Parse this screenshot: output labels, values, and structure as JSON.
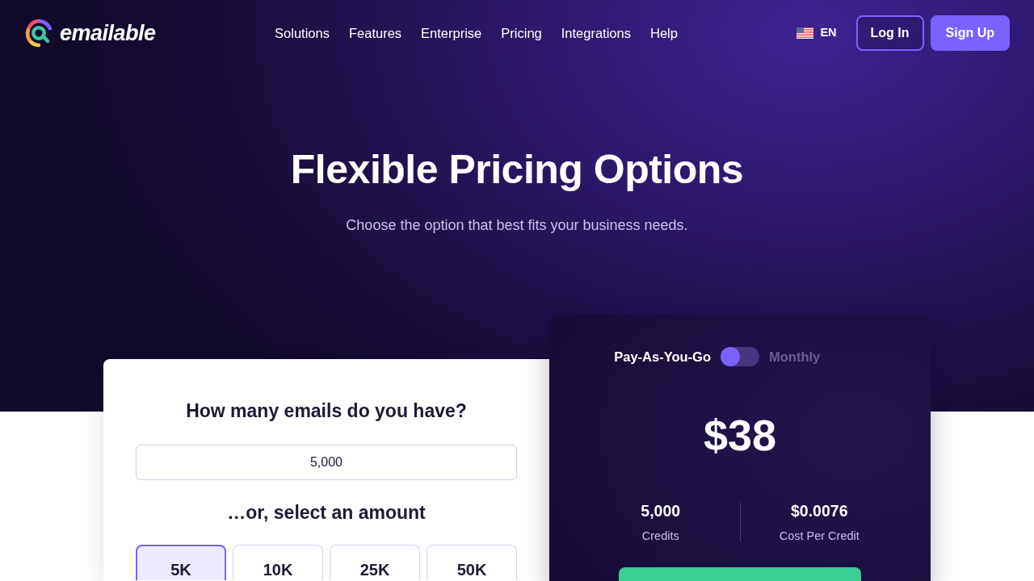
{
  "brand": {
    "name": "emailable"
  },
  "nav": {
    "links": [
      "Solutions",
      "Features",
      "Enterprise",
      "Pricing",
      "Integrations",
      "Help"
    ]
  },
  "language": {
    "code": "EN"
  },
  "auth_buttons": [
    {
      "label": "Log In",
      "kind": "outline"
    },
    {
      "label": "Sign Up",
      "kind": "solid"
    }
  ],
  "hero": {
    "title": "Flexible Pricing Options",
    "subtitle": "Choose the option that best fits your business needs."
  },
  "amount_panel": {
    "heading": "How many emails do you have?",
    "input": {
      "value": "5,000"
    },
    "alt_heading": "…or, select an amount",
    "options": [
      {
        "label": "5K",
        "selected": true
      },
      {
        "label": "10K",
        "selected": false
      },
      {
        "label": "25K",
        "selected": false
      },
      {
        "label": "50K",
        "selected": false
      }
    ]
  },
  "price_panel": {
    "billing": {
      "left_label": "Pay-As-You-Go",
      "right_label": "Monthly",
      "monthly": false
    },
    "price": "$38",
    "stats": [
      {
        "value": "5,000",
        "label": "Credits"
      },
      {
        "value": "$0.0076",
        "label": "Cost Per Credit"
      }
    ]
  }
}
